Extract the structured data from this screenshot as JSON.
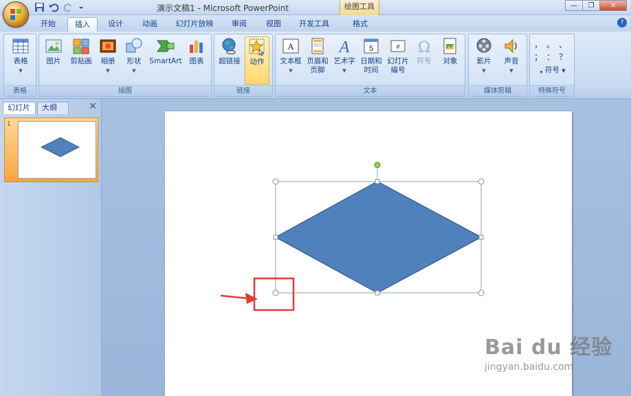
{
  "window": {
    "title": "演示文稿1 - Microsoft PowerPoint",
    "context_tab": "绘图工具"
  },
  "tabs": [
    {
      "label": "开始"
    },
    {
      "label": "插入",
      "active": true
    },
    {
      "label": "设计"
    },
    {
      "label": "动画"
    },
    {
      "label": "幻灯片放映"
    },
    {
      "label": "审阅"
    },
    {
      "label": "视图"
    },
    {
      "label": "开发工具"
    },
    {
      "label": "格式"
    }
  ],
  "ribbon": {
    "groups": {
      "table": "表格",
      "illustrations": "插图",
      "links": "链接",
      "text": "文本",
      "media": "媒体剪辑",
      "special": "特殊符号"
    },
    "buttons": {
      "table": "表格",
      "picture": "图片",
      "clipart": "剪贴画",
      "album": "相册",
      "shapes": "形状",
      "smartart": "SmartArt",
      "chart": "图表",
      "hyperlink": "超链接",
      "action": "动作",
      "textbox": "文本框",
      "header_footer_1": "页眉和",
      "header_footer_2": "页脚",
      "wordart": "艺术字",
      "datetime_1": "日期和",
      "datetime_2": "时间",
      "slide_num_1": "幻灯片",
      "slide_num_2": "编号",
      "symbol": "符号",
      "object": "对象",
      "movie": "影片",
      "sound": "声音",
      "special_symbol": "符号"
    },
    "symbols": [
      "，",
      "。",
      "、",
      "；",
      "：",
      "？"
    ]
  },
  "pane": {
    "tab_slides": "幻灯片",
    "tab_outline": "大纲",
    "slide_number": "1"
  },
  "colors": {
    "diamond_fill": "#4f81bd",
    "diamond_stroke": "#3c6494",
    "annotation_red": "#e53935",
    "rotate_handle": "#8fd14f"
  },
  "watermark": {
    "brand": "Bai du 经验",
    "url": "jingyan.baidu.com"
  }
}
